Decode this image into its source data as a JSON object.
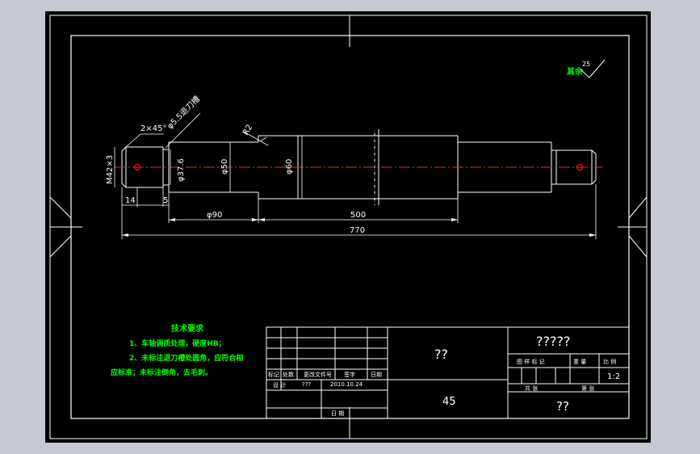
{
  "drawing": {
    "roughness_note": {
      "label": "其余",
      "value": "25"
    },
    "dimensions": {
      "chamfer": "2×45°",
      "groove": "φ5.5退刀槽",
      "fillet": "R2",
      "thread": "M42×3",
      "d_groove": "φ37.6",
      "d_50": "φ50",
      "d_60": "φ60",
      "len_14": "14",
      "len_5": "5",
      "len_90": "φ90",
      "len_500": "500",
      "len_770": "770"
    },
    "tech_requirements": {
      "title": "技术要求",
      "line1": "1、车轴调质处理，硬度HB；",
      "line2": "2、未标注退刀槽处圆角，应符合相",
      "line3": "应标准；未标注倒角，去毛刺。"
    },
    "title_block": {
      "part_name": "??",
      "material": "45",
      "drawing_no": "?????",
      "company": "??",
      "scale": "1:2",
      "headers": {
        "mark": "标记",
        "count": "处数",
        "change_doc": "更改文件号",
        "sign": "签字",
        "date": "日期",
        "design": "设  计",
        "designer": "???",
        "design_date": "2010.10.24",
        "date_label": "日  期",
        "stage_mark": "图 样 标 记",
        "weight": "重  量",
        "scale_label": "比  例",
        "total": "共    张",
        "sheet": "第    张"
      }
    }
  }
}
